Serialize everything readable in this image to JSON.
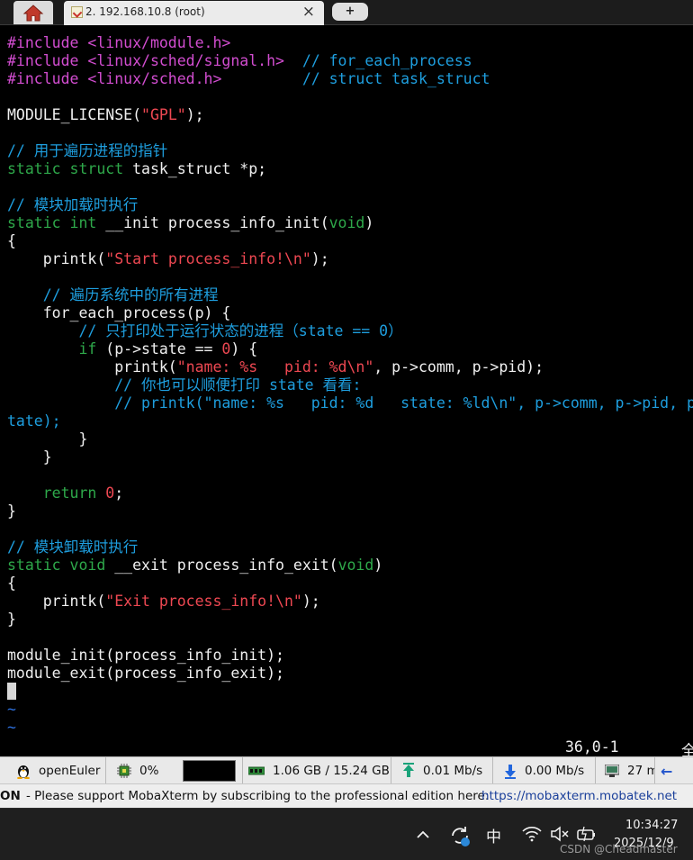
{
  "tabs": {
    "session_label": "2. 192.168.10.8 (root)",
    "close_symbol": "×",
    "new_tab_symbol": "+"
  },
  "code_lines": [
    [
      {
        "t": "#include <linux/module.h>",
        "c": "pp"
      }
    ],
    [
      {
        "t": "#include <linux/sched/signal.h>",
        "c": "pp"
      },
      {
        "t": "  // for_each_process",
        "c": "cm"
      }
    ],
    [
      {
        "t": "#include <linux/sched.h>",
        "c": "pp"
      },
      {
        "t": "         // struct task_struct",
        "c": "cm"
      }
    ],
    [],
    [
      {
        "t": "MODULE_LICENSE("
      },
      {
        "t": "\"GPL\"",
        "c": "str"
      },
      {
        "t": ");"
      }
    ],
    [],
    [
      {
        "t": "// 用于遍历进程的指针",
        "c": "cm"
      }
    ],
    [
      {
        "t": "static struct",
        "c": "kw"
      },
      {
        "t": " task_struct *p;"
      }
    ],
    [],
    [
      {
        "t": "// 模块加载时执行",
        "c": "cm"
      }
    ],
    [
      {
        "t": "static int",
        "c": "kw"
      },
      {
        "t": " __init process_info_init("
      },
      {
        "t": "void",
        "c": "kw"
      },
      {
        "t": ")"
      }
    ],
    [
      {
        "t": "{"
      }
    ],
    [
      {
        "t": "    printk("
      },
      {
        "t": "\"Start process_info!\\n\"",
        "c": "str"
      },
      {
        "t": ");"
      }
    ],
    [],
    [
      {
        "t": "    // 遍历系统中的所有进程",
        "c": "cm"
      }
    ],
    [
      {
        "t": "    for_each_process(p) {"
      }
    ],
    [
      {
        "t": "        // 只打印处于运行状态的进程（state == 0）",
        "c": "cm"
      }
    ],
    [
      {
        "t": "        if",
        "c": "kw"
      },
      {
        "t": " (p->state == "
      },
      {
        "t": "0",
        "c": "nm"
      },
      {
        "t": ") {"
      }
    ],
    [
      {
        "t": "            printk("
      },
      {
        "t": "\"name: %s   pid: %d\\n\"",
        "c": "str"
      },
      {
        "t": ", p->comm, p->pid);"
      }
    ],
    [
      {
        "t": "            // 你也可以顺便打印 state 看看:",
        "c": "cm"
      }
    ],
    [
      {
        "t": "            // printk(\"name: %s   pid: %d   state: %ld\\n\", p->comm, p->pid, p->s",
        "c": "cm"
      }
    ],
    [
      {
        "t": "tate);",
        "c": "cm"
      }
    ],
    [
      {
        "t": "        }"
      }
    ],
    [
      {
        "t": "    }"
      }
    ],
    [],
    [
      {
        "t": "    return",
        "c": "kw"
      },
      {
        "t": " "
      },
      {
        "t": "0",
        "c": "nm"
      },
      {
        "t": ";"
      }
    ],
    [
      {
        "t": "}"
      }
    ],
    [],
    [
      {
        "t": "// 模块卸载时执行",
        "c": "cm"
      }
    ],
    [
      {
        "t": "static void",
        "c": "kw"
      },
      {
        "t": " __exit process_info_exit("
      },
      {
        "t": "void",
        "c": "kw"
      },
      {
        "t": ")"
      }
    ],
    [
      {
        "t": "{"
      }
    ],
    [
      {
        "t": "    printk("
      },
      {
        "t": "\"Exit process_info!\\n\"",
        "c": "str"
      },
      {
        "t": ");"
      }
    ],
    [
      {
        "t": "}"
      }
    ],
    [],
    [
      {
        "t": "module_init(process_info_init);"
      }
    ],
    [
      {
        "t": "module_exit(process_info_exit);"
      }
    ],
    [
      {
        "t": "",
        "cursor": true
      }
    ],
    [
      {
        "t": "~",
        "c": "tilde"
      }
    ],
    [
      {
        "t": "~",
        "c": "tilde"
      }
    ]
  ],
  "vim_status": {
    "position": "36,0-1",
    "percent": "全"
  },
  "statusbar": {
    "os": "openEuler",
    "cpu": "0%",
    "memory": "1.06 GB / 15.24 GB",
    "upload": "0.01 Mb/s",
    "download": "0.00 Mb/s",
    "uptime": "27 m"
  },
  "promo": {
    "tag": "ON",
    "text": "-  Please support MobaXterm by subscribing to the professional edition here:",
    "link": "https://mobaxterm.mobatek.net"
  },
  "taskbar": {
    "ime": "中",
    "time": "10:34:27",
    "date": "2025/12/9",
    "watermark": "CSDN @Cheadmaster"
  },
  "colors": {
    "preprocessor": "#d24dd0",
    "string": "#ee4852",
    "comment": "#1e9ede",
    "keyword": "#2ea84a",
    "terminal_bg": "#000000"
  },
  "icons": [
    "home-icon",
    "terminal-session-icon",
    "close-icon",
    "linux-tux-icon",
    "cpu-icon",
    "memory-icon",
    "upload-icon",
    "download-icon",
    "uptime-icon",
    "chevron-up-icon",
    "sync-icon",
    "wifi-icon",
    "volume-muted-icon",
    "battery-icon"
  ]
}
